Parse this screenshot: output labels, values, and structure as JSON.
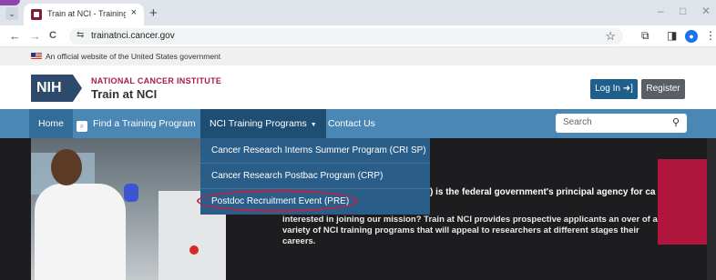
{
  "browser": {
    "tab_title": "Train at NCI - Training Program",
    "tab_close": "×",
    "new_tab": "+",
    "url": "trainatnci.cancer.gov",
    "back": "←",
    "forward": "→",
    "reload": "C",
    "minimize": "–",
    "maximize": "□",
    "close": "✕"
  },
  "gov_banner": {
    "text": "An official website of the United States government"
  },
  "header": {
    "logo_text": "NIH",
    "org_name": "NATIONAL CANCER INSTITUTE",
    "site_name": "Train at NCI",
    "login_label": "Log In ➜]",
    "register_label": "Register"
  },
  "nav": {
    "home": "Home",
    "find": "Find a Training Program",
    "programs": "NCI Training Programs",
    "contact": "Contact Us",
    "search_placeholder": "Search"
  },
  "dropdown": {
    "items": [
      "Cancer Research Interns Summer Program (CRI SP)",
      "Cancer Research Postbac Program (CRP)",
      "Postdoc Recruitment Event (PRE)"
    ],
    "highlighted_index": 2
  },
  "hero": {
    "line1": ") is the federal government's principal agency for ca",
    "line2": "interested in joining our mission? Train at NCI provides prospective applicants an over of a variety of NCI training programs that will appeal to researchers at different stages their careers."
  },
  "colors": {
    "nav": "#4a87b5",
    "dropdown": "#2a5d88",
    "brand_red": "#a61d42",
    "accent_panel": "#b0163d"
  }
}
